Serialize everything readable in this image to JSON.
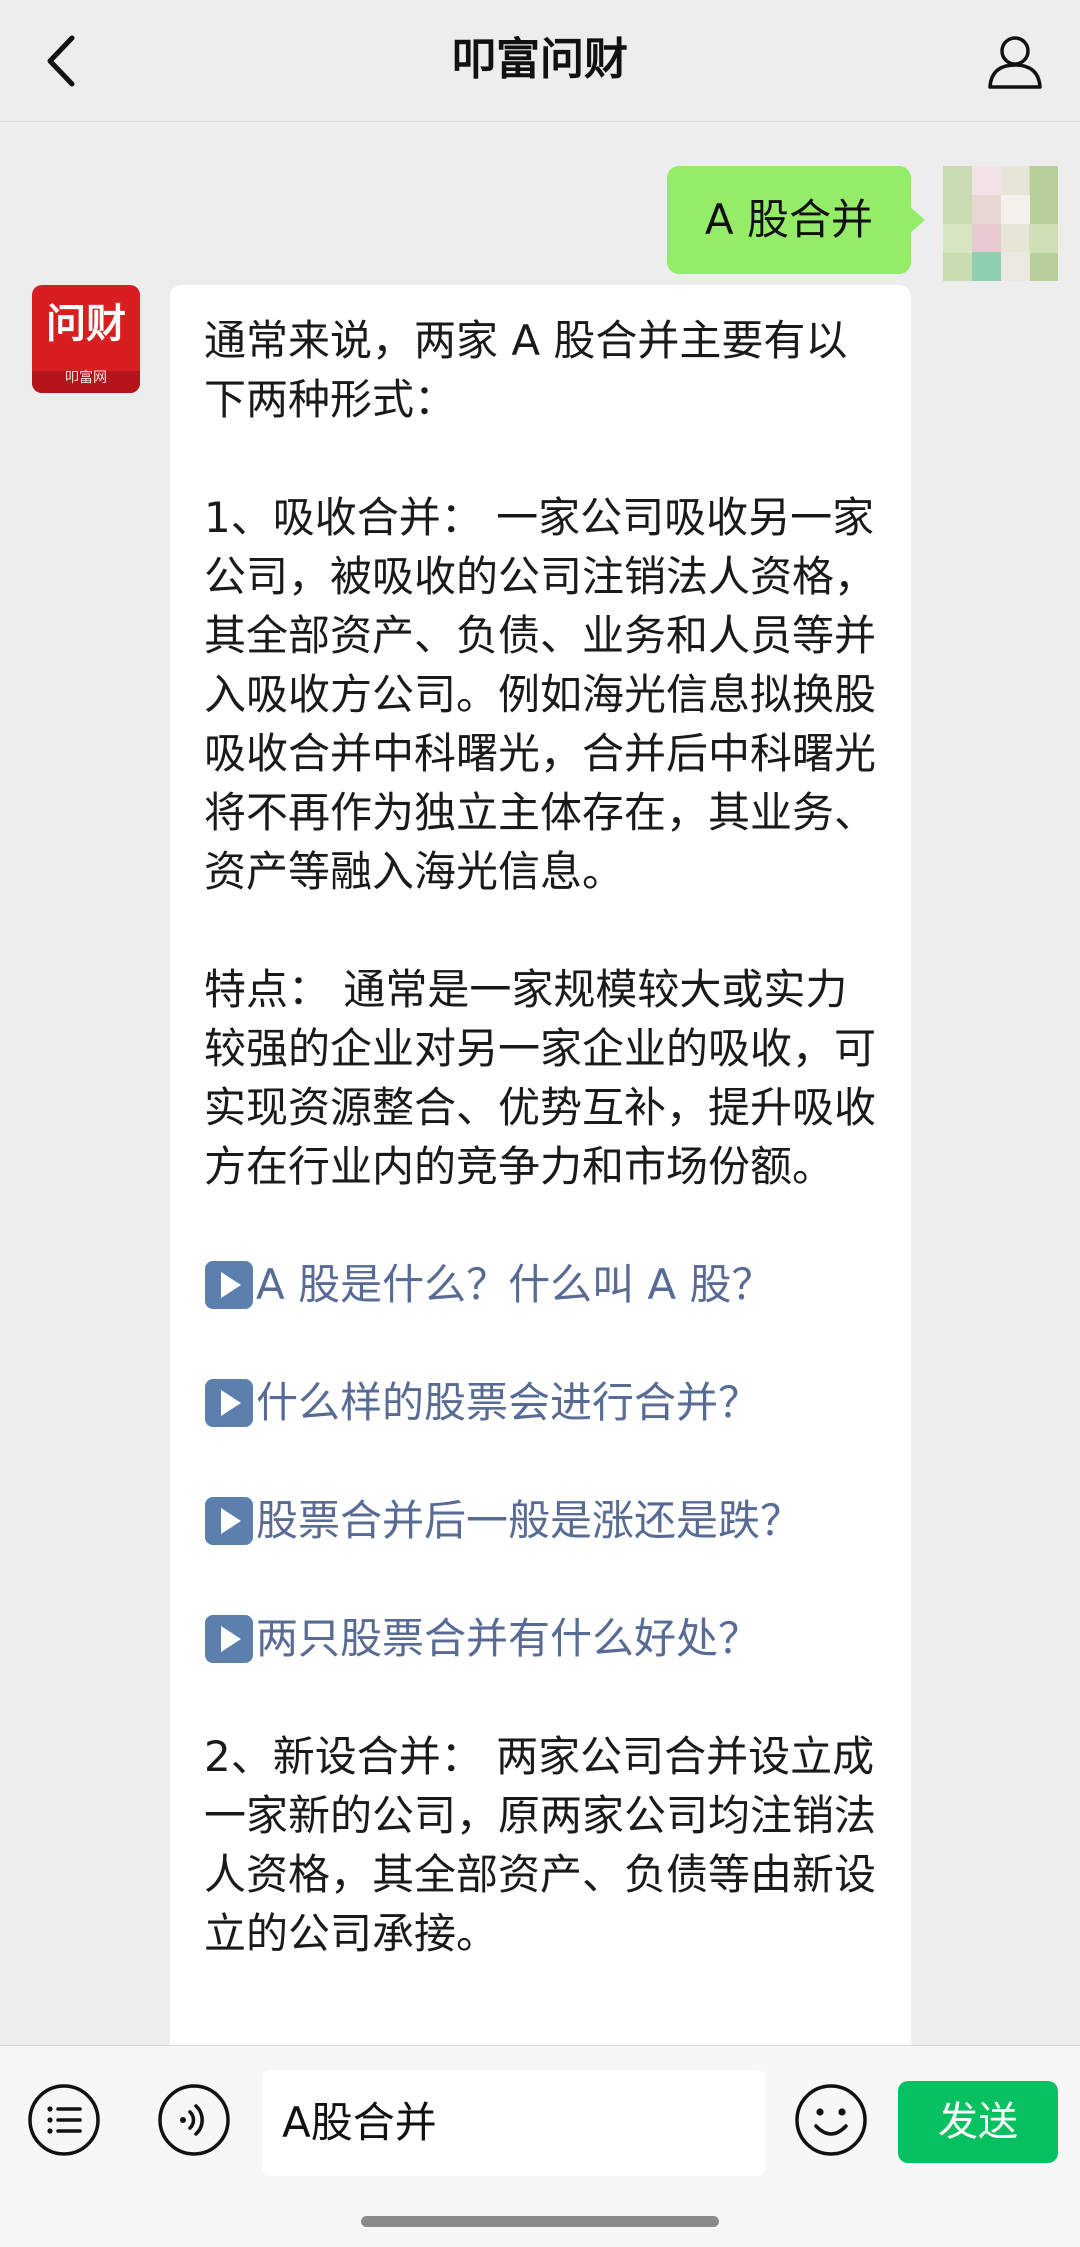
{
  "header": {
    "title": "叩富问财"
  },
  "chat": {
    "user_message": "A 股合并",
    "bot_logo_text": "问财",
    "bot_logo_sub": "叩富网",
    "bot_paragraphs": [
      "通常来说，两家 A 股合并主要有以下两种形式：",
      "1、吸收合并： 一家公司吸收另一家公司，被吸收的公司注销法人资格，其全部资产、负债、业务和人员等并入吸收方公司。例如海光信息拟换股吸收合并中科曙光，合并后中科曙光将不再作为独立主体存在，其业务、资产等融入海光信息。",
      "特点： 通常是一家规模较大或实力较强的企业对另一家企业的吸收，可实现资源整合、优势互补，提升吸收方在行业内的竞争力和市场份额。"
    ],
    "links": [
      "A 股是什么？什么叫 A 股？",
      "什么样的股票会进行合并？",
      "股票合并后一般是涨还是跌？",
      "两只股票合并有什么好处？"
    ],
    "bot_paragraph_after": "2、新设合并： 两家公司合并设立成一家新的公司，原两家公司均注销法人资格，其全部资产、负债等由新设立的公司承接。"
  },
  "input": {
    "value": "A股合并",
    "send_label": "发送"
  },
  "colors": {
    "user_bubble": "#95ec69",
    "link": "#576b95",
    "send_button": "#07c160",
    "brand_red": "#d81e21"
  }
}
